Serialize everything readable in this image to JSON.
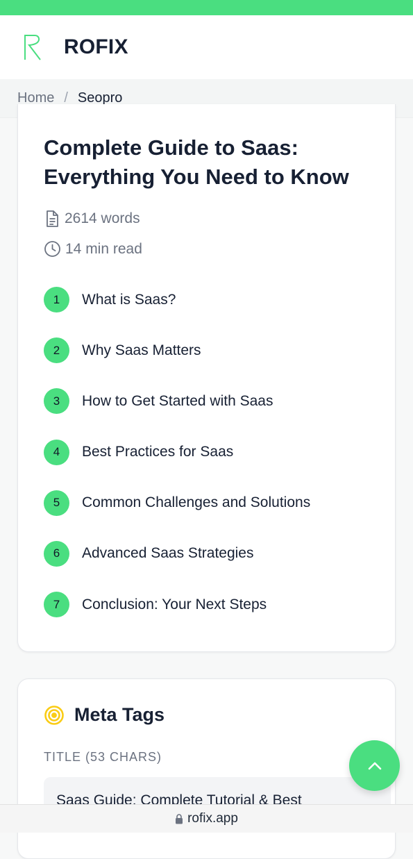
{
  "header": {
    "brand": "ROFIX",
    "logo_icon": "rofix-logo-icon"
  },
  "breadcrumb": {
    "home": "Home",
    "separator": "/",
    "current": "Seopro"
  },
  "article": {
    "title": "Complete Guide to Saas: Everything You Need to Know",
    "words": "2614 words",
    "read_time": "14 min read",
    "toc": [
      {
        "num": "1",
        "label": "What is Saas?"
      },
      {
        "num": "2",
        "label": "Why Saas Matters"
      },
      {
        "num": "3",
        "label": "How to Get Started with Saas"
      },
      {
        "num": "4",
        "label": "Best Practices for Saas"
      },
      {
        "num": "5",
        "label": "Common Challenges and Solutions"
      },
      {
        "num": "6",
        "label": "Advanced Saas Strategies"
      },
      {
        "num": "7",
        "label": "Conclusion: Your Next Steps"
      }
    ]
  },
  "meta_tags": {
    "heading": "Meta Tags",
    "title_label": "TITLE (53 CHARS)",
    "title_value": "Saas Guide: Complete Tutorial & Best"
  },
  "browser": {
    "url": "rofix.app"
  },
  "colors": {
    "accent": "#4ade80",
    "text": "#172033",
    "muted": "#6b7280",
    "target": "#facc15"
  }
}
